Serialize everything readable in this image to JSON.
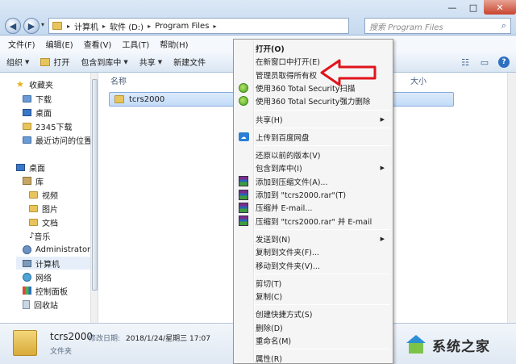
{
  "window": {
    "address": {
      "crumbs": [
        "计算机",
        "软件 (D:)",
        "Program Files"
      ]
    },
    "search_placeholder": "搜索 Program Files",
    "controls": {
      "minimize": "—",
      "maximize": "□",
      "close": "✕"
    }
  },
  "menubar": [
    "文件(F)",
    "编辑(E)",
    "查看(V)",
    "工具(T)",
    "帮助(H)"
  ],
  "toolbar": {
    "organize": "组织",
    "open": "打开",
    "include_in_library": "包含到库中",
    "share": "共享",
    "new_folder": "新建文件"
  },
  "sidebar": {
    "favorites": {
      "title": "收藏夹",
      "items": [
        "下载",
        "桌面",
        "2345下载",
        "最近访问的位置"
      ]
    },
    "desktop": "桌面",
    "libraries": {
      "title": "库",
      "items": [
        "视频",
        "图片",
        "文档",
        "音乐"
      ]
    },
    "user": "Administrator",
    "computer": "计算机",
    "network": "网络",
    "control_panel": "控制面板",
    "recycle_bin": "回收站"
  },
  "content": {
    "columns": {
      "name": "名称",
      "size": "大小"
    },
    "files": [
      {
        "name": "tcrs2000"
      }
    ]
  },
  "details": {
    "name": "tcrs2000",
    "modified_label": "修改日期:",
    "modified_value": "2018/1/24/星期三 17:07",
    "type": "文件夹"
  },
  "context_menu": {
    "groups": [
      [
        {
          "label": "打开(O)",
          "bold": true
        },
        {
          "label": "在新窗口中打开(E)"
        },
        {
          "label": "管理员取得所有权"
        },
        {
          "label": "使用360 Total Security扫描",
          "icon": "360"
        },
        {
          "label": "使用360 Total Security强力删除",
          "icon": "360"
        }
      ],
      [
        {
          "label": "共享(H)",
          "submenu": true
        }
      ],
      [
        {
          "label": "上传到百度网盘",
          "icon": "cloud"
        }
      ],
      [
        {
          "label": "还原以前的版本(V)"
        },
        {
          "label": "包含到库中(I)",
          "submenu": true
        },
        {
          "label": "添加到压缩文件(A)...",
          "icon": "rar"
        },
        {
          "label": "添加到 \"tcrs2000.rar\"(T)",
          "icon": "rar"
        },
        {
          "label": "压缩并 E-mail...",
          "icon": "rar"
        },
        {
          "label": "压缩到 \"tcrs2000.rar\" 并 E-mail",
          "icon": "rar"
        }
      ],
      [
        {
          "label": "发送到(N)",
          "submenu": true
        },
        {
          "label": "复制到文件夹(F)..."
        },
        {
          "label": "移动到文件夹(V)..."
        }
      ],
      [
        {
          "label": "剪切(T)"
        },
        {
          "label": "复制(C)"
        }
      ],
      [
        {
          "label": "创建快捷方式(S)"
        },
        {
          "label": "删除(D)"
        },
        {
          "label": "重命名(M)"
        }
      ],
      [
        {
          "label": "属性(R)"
        }
      ]
    ]
  },
  "watermark": {
    "text": "系统之家"
  },
  "colors": {
    "annotation_arrow": "#e0141c",
    "selection": "#cce0f8"
  }
}
